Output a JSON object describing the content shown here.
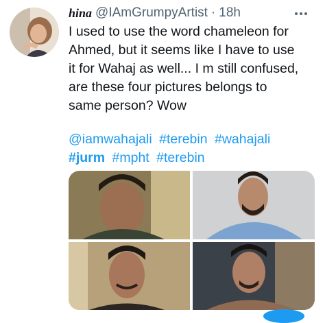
{
  "tweet": {
    "display_name": "hina",
    "handle": "@IAmGrumpyArtist",
    "separator": "·",
    "time": "18h",
    "text": "I used to use the word chameleon for\nAhmed, but it seems like I have to use\nit for Wahaj as well... I m still confused,\nare these four pictures belongs to\nsame person? Wow",
    "hashtags": [
      "@iamwahajali",
      "#terebin",
      "#wahajali",
      "#jurm",
      "#mpht",
      "#terebin"
    ],
    "photos": [
      "photo-1",
      "photo-2",
      "photo-3",
      "photo-4"
    ]
  },
  "colors": {
    "link": "#1d9bf0",
    "text": "#0f1419",
    "muted": "#536471"
  },
  "icons": {
    "more": "more-icon",
    "avatar": "avatar"
  }
}
